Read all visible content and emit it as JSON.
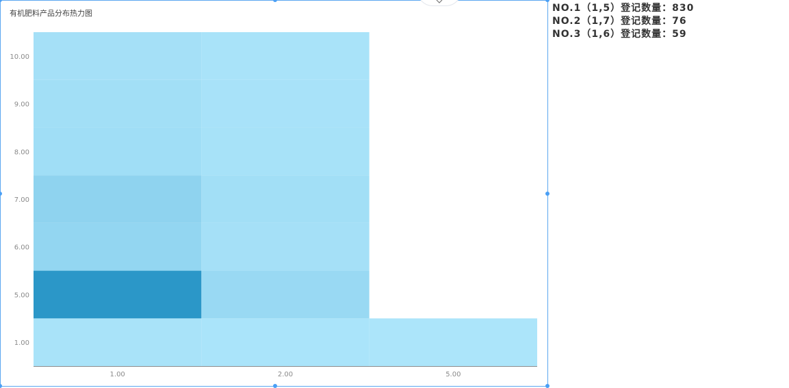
{
  "chart_data": {
    "type": "heatmap",
    "title": "有机肥料产品分布热力图",
    "x_categories": [
      "1.00",
      "2.00",
      "5.00"
    ],
    "y_categories": [
      "1.00",
      "5.00",
      "6.00",
      "7.00",
      "8.00",
      "9.00",
      "10.00"
    ],
    "cells": [
      {
        "x": "1.00",
        "y": "1.00",
        "value": 4
      },
      {
        "x": "1.00",
        "y": "5.00",
        "value": 830
      },
      {
        "x": "1.00",
        "y": "6.00",
        "value": 59
      },
      {
        "x": "1.00",
        "y": "7.00",
        "value": 76
      },
      {
        "x": "1.00",
        "y": "8.00",
        "value": 20
      },
      {
        "x": "1.00",
        "y": "9.00",
        "value": 15
      },
      {
        "x": "1.00",
        "y": "10.00",
        "value": 10
      },
      {
        "x": "2.00",
        "y": "1.00",
        "value": 2
      },
      {
        "x": "2.00",
        "y": "5.00",
        "value": 40
      },
      {
        "x": "2.00",
        "y": "6.00",
        "value": 10
      },
      {
        "x": "2.00",
        "y": "7.00",
        "value": 15
      },
      {
        "x": "2.00",
        "y": "8.00",
        "value": 6
      },
      {
        "x": "2.00",
        "y": "9.00",
        "value": 5
      },
      {
        "x": "2.00",
        "y": "10.00",
        "value": 4
      },
      {
        "x": "5.00",
        "y": "1.00",
        "value": 1
      }
    ],
    "color_range": [
      "#aee6fb",
      "#2b97c8"
    ],
    "value_range": [
      0,
      830
    ]
  },
  "ranking": [
    "NO.1（1,5）登记数量：830",
    "NO.2（1,7）登记数量：76",
    "NO.3（1,6）登记数量：59"
  ],
  "icons": {
    "collapse": "chevron-down-icon"
  }
}
